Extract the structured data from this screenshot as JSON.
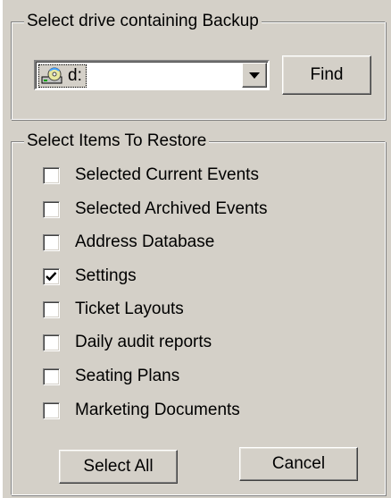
{
  "drive_group": {
    "title": "Select drive containing Backup",
    "drive_value": "d:",
    "drive_icon": "cd-drive-icon",
    "find_label": "Find"
  },
  "restore_group": {
    "title": "Select Items To Restore",
    "items": [
      {
        "label": "Selected Current Events",
        "checked": false
      },
      {
        "label": "Selected Archived Events",
        "checked": false
      },
      {
        "label": "Address Database",
        "checked": false
      },
      {
        "label": "Settings",
        "checked": true
      },
      {
        "label": "Ticket Layouts",
        "checked": false
      },
      {
        "label": "Daily audit reports",
        "checked": false
      },
      {
        "label": "Seating Plans",
        "checked": false
      },
      {
        "label": "Marketing Documents",
        "checked": false
      }
    ]
  },
  "buttons": {
    "select_all_label": "Select All",
    "cancel_label": "Cancel"
  }
}
